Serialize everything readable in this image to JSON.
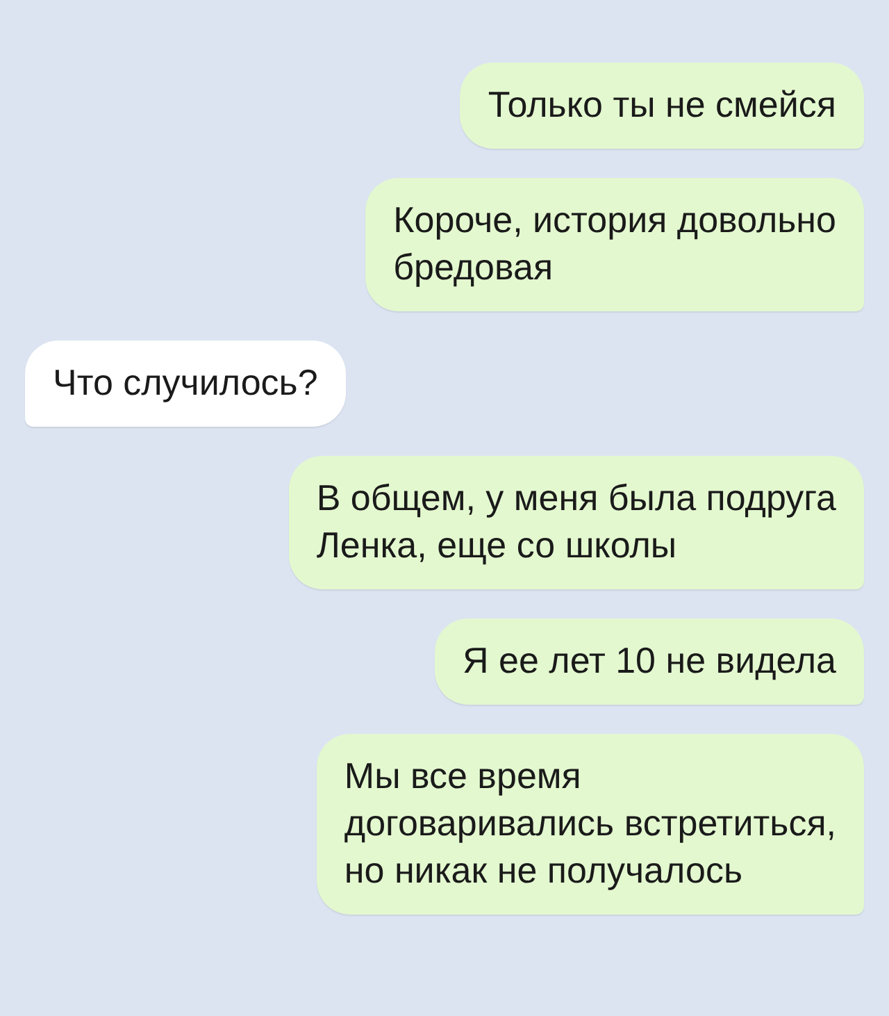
{
  "messages": [
    {
      "kind": "outgoing",
      "lines": [
        "Только ты не смейся"
      ]
    },
    {
      "kind": "outgoing",
      "lines": [
        "Короче, история довольно",
        "бредовая"
      ]
    },
    {
      "kind": "incoming",
      "lines": [
        "Что случилось?"
      ]
    },
    {
      "kind": "outgoing",
      "lines": [
        "В общем, у меня была подруга",
        "Ленка, еще со школы"
      ]
    },
    {
      "kind": "outgoing",
      "lines": [
        "Я ее лет 10 не видела"
      ]
    },
    {
      "kind": "outgoing",
      "lines": [
        "Мы все время",
        "договаривались встретиться,",
        "но никак не получалось"
      ]
    }
  ]
}
